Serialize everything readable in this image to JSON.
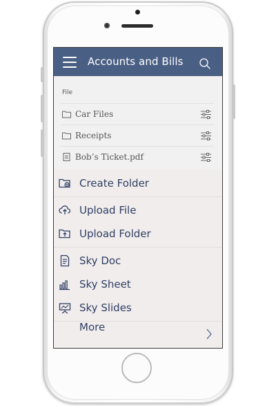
{
  "app": {
    "title": "Accounts and Bills"
  },
  "file_section": {
    "label": "File",
    "items": [
      {
        "name": "Car Files",
        "icon": "folder-icon"
      },
      {
        "name": "Receipts",
        "icon": "folder-icon"
      },
      {
        "name": "Bob’s Ticket.pdf",
        "icon": "document-icon"
      }
    ]
  },
  "menu": {
    "create_folder": "Create Folder",
    "upload_file": "Upload File",
    "upload_folder": "Upload Folder",
    "sky_doc": "Sky Doc",
    "sky_sheet": "Sky Sheet",
    "sky_slides": "Sky Slides",
    "more": "More"
  },
  "colors": {
    "header": "#4a5f84",
    "menu_bg": "#f1eded",
    "accent_text": "#2f3e62"
  }
}
